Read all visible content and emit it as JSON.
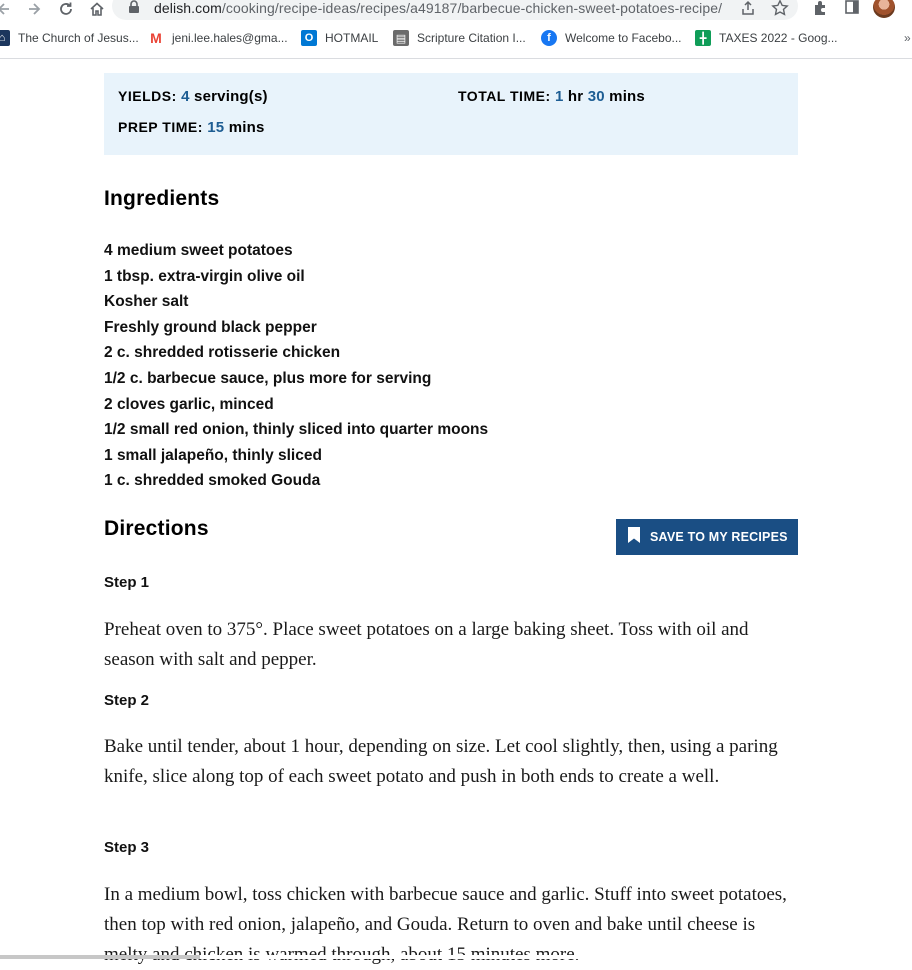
{
  "browser": {
    "url_domain": "delish.com",
    "url_path": "/cooking/recipe-ideas/recipes/a49187/barbecue-chicken-sweet-potatoes-recipe/",
    "bookmarks": [
      {
        "label": "The Church of Jesus...",
        "icon": "church-icon",
        "color": "#1b365d"
      },
      {
        "label": "jeni.lee.hales@gma...",
        "icon": "gmail-icon",
        "color": "#ea4335"
      },
      {
        "label": "HOTMAIL",
        "icon": "outlook-icon",
        "color": "#0078d4"
      },
      {
        "label": "Scripture Citation I...",
        "icon": "scripture-icon",
        "color": "#6b6b6b"
      },
      {
        "label": "Welcome to Facebo...",
        "icon": "facebook-icon",
        "color": "#1877f2"
      },
      {
        "label": "TAXES 2022 - Goog...",
        "icon": "sheets-icon",
        "color": "#0f9d58"
      }
    ]
  },
  "recipe": {
    "yields_label": "YIELDS:",
    "yields_value": "4",
    "yields_unit": "serving(s)",
    "total_label": "TOTAL TIME:",
    "total_hr": "1",
    "total_hr_unit": "hr",
    "total_min": "30",
    "total_min_unit": "mins",
    "prep_label": "PREP TIME:",
    "prep_value": "15",
    "prep_unit": "mins",
    "ingredients_heading": "Ingredients",
    "ingredients": [
      {
        "amount": "4",
        "text": "medium sweet potatoes"
      },
      {
        "amount": "1 tbsp.",
        "text": "extra-virgin olive oil"
      },
      {
        "amount": "",
        "text": "Kosher salt"
      },
      {
        "amount": "",
        "text": "Freshly ground black pepper"
      },
      {
        "amount": "2 c.",
        "text": "shredded rotisserie chicken"
      },
      {
        "amount": "1/2 c.",
        "text": "barbecue sauce, plus more for serving"
      },
      {
        "amount": "2",
        "text": "cloves garlic, minced"
      },
      {
        "amount": "1/2",
        "text": "small red onion, thinly sliced into quarter moons"
      },
      {
        "amount": "1",
        "text": "small jalapeño, thinly sliced"
      },
      {
        "amount": "1 c.",
        "text": "shredded smoked Gouda"
      }
    ],
    "directions_heading": "Directions",
    "save_label": "SAVE TO MY RECIPES",
    "steps": [
      {
        "title": "Step 1",
        "text": "Preheat  oven to 375°.  Place sweet potatoes on a large baking sheet. Toss with oil and season with salt and pepper."
      },
      {
        "title": "Step 2",
        "text": "Bake until tender, about 1 hour, depending on size. Let cool slightly, then, using a paring knife, slice along top of each sweet potato and push in both ends to create a well."
      },
      {
        "title": "Step 3",
        "text": "In a medium bowl, toss chicken with barbecue sauce and garlic. Stuff into sweet potatoes, then top with red onion, jalapeño, and Gouda. Return to oven and bake until cheese is melty and chicken is warmed through, about 15 minutes more."
      }
    ]
  },
  "colors": {
    "accent": "#1d5d93",
    "meta_bg": "#e8f3fb",
    "button_bg": "#1a4e84"
  }
}
